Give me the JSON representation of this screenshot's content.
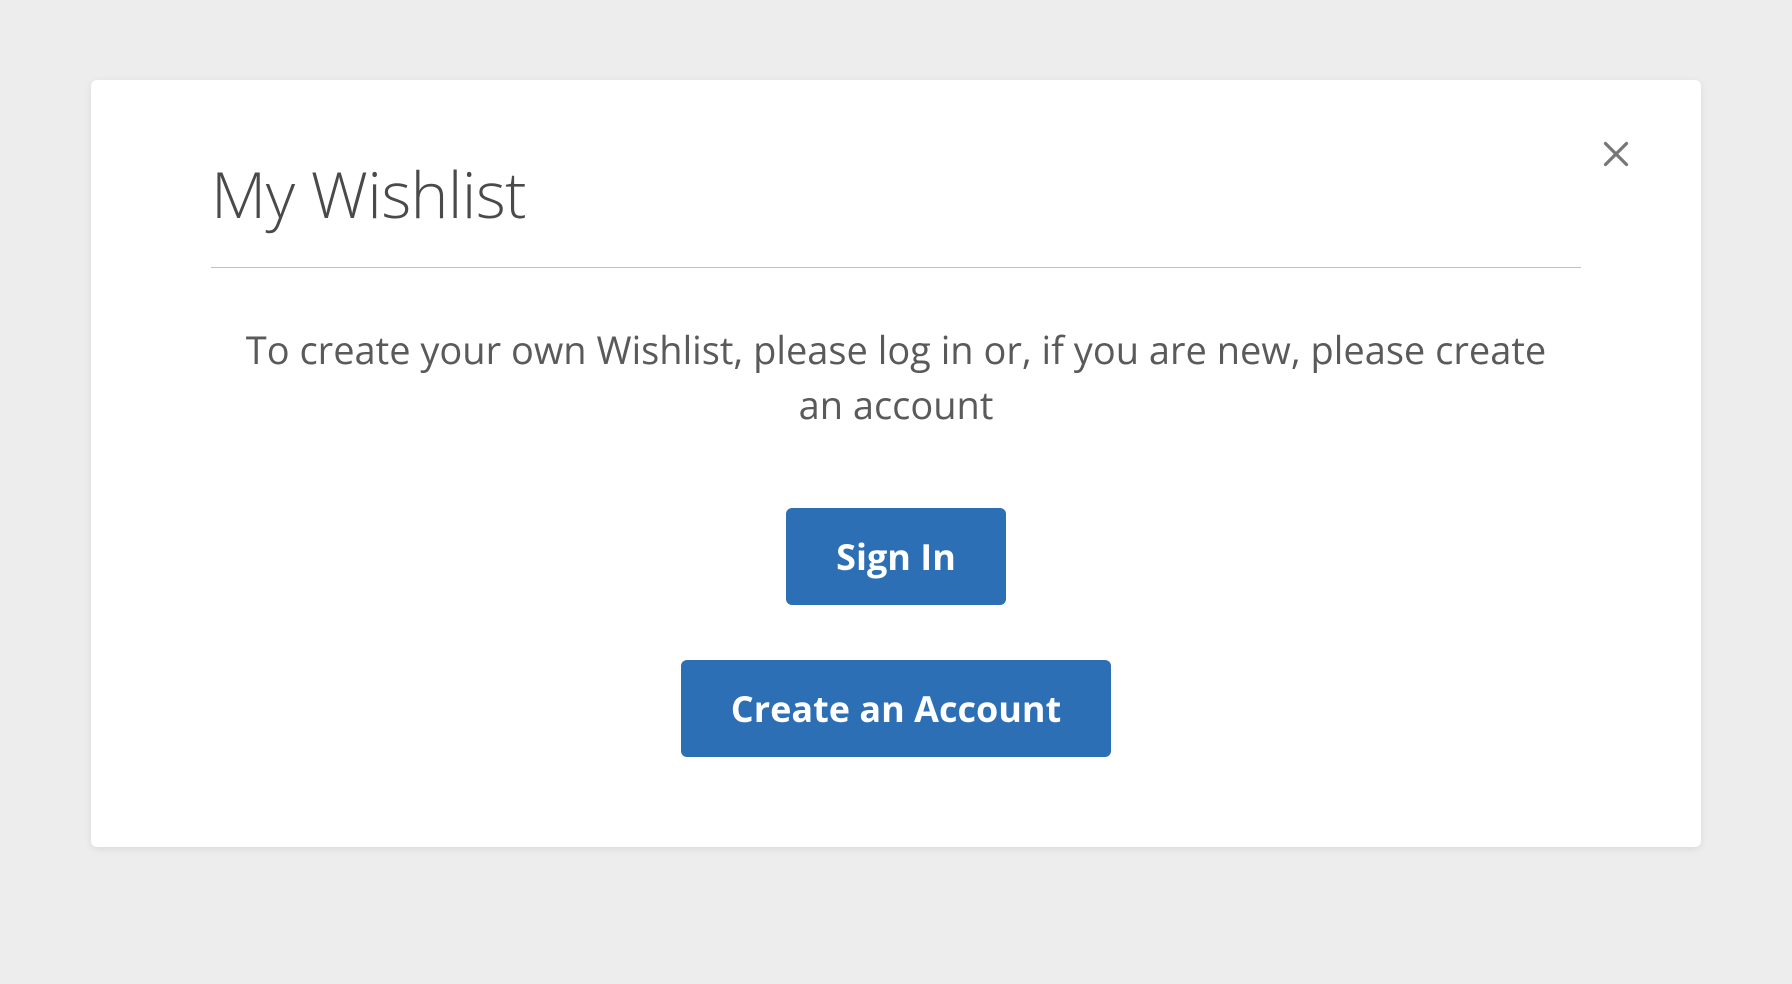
{
  "modal": {
    "title": "My Wishlist",
    "description": "To create your own Wishlist, please log in or, if you are new, please create an account",
    "sign_in_label": "Sign In",
    "create_account_label": "Create an Account"
  }
}
